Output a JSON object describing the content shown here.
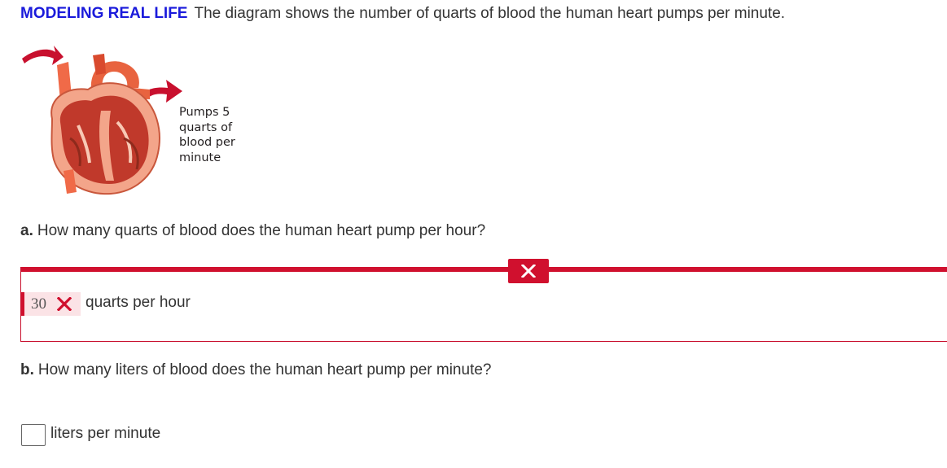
{
  "problem": {
    "tag": "MODELING REAL LIFE",
    "text": "The diagram shows the number of quarts of blood the human heart pumps per minute."
  },
  "figure": {
    "caption_lines": [
      "Pumps 5",
      "quarts of",
      "blood per",
      "minute"
    ],
    "colors": {
      "arrow": "#c8102e",
      "heart_outer": "#e8633f",
      "heart_inner": "#b8321e",
      "muscle": "#f3a58a"
    }
  },
  "part_a": {
    "label": "a.",
    "question": "How many quarts of blood does the human heart pump per hour?",
    "answer_value": "30",
    "answer_status": "incorrect",
    "unit": "quarts per hour",
    "feedback_icon": "close-icon"
  },
  "part_b": {
    "label": "b.",
    "question": "How many liters of blood does the human heart pump per minute?",
    "answer_value": "",
    "unit": "liters per minute"
  },
  "colors": {
    "tag": "#1a1adb",
    "error": "#d0102e",
    "error_bg": "#fbe3e6",
    "text": "#333333"
  }
}
